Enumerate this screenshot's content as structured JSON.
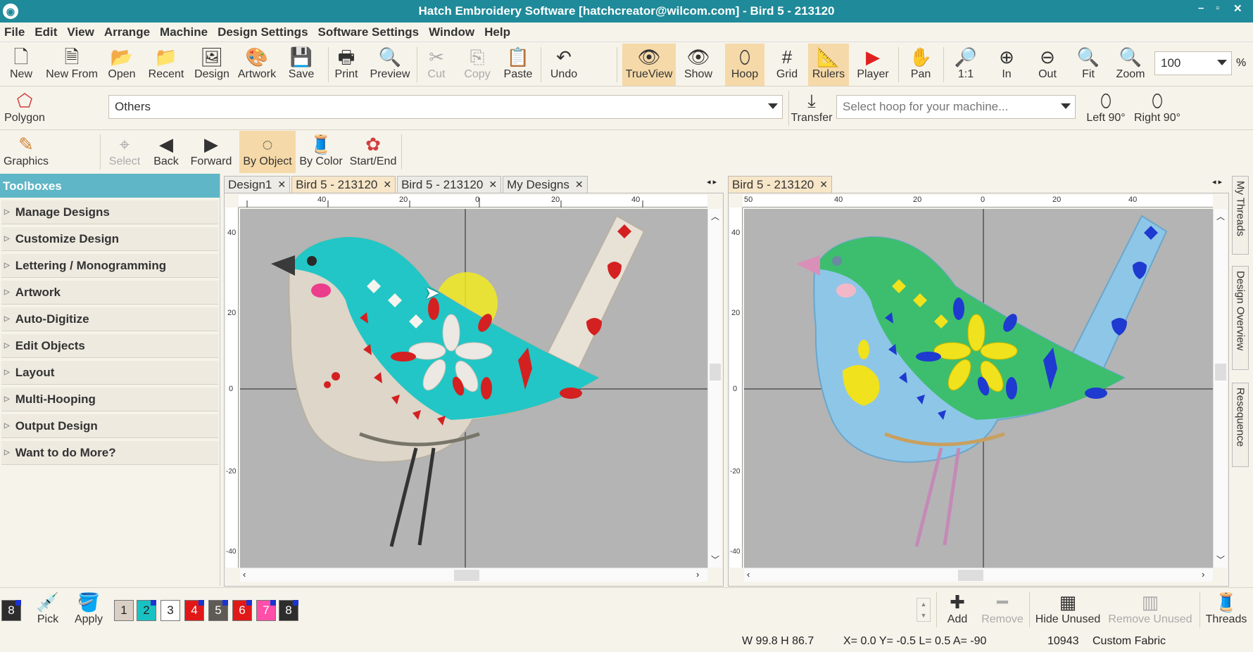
{
  "window": {
    "title": "Hatch Embroidery Software [hatchcreator@wilcom.com] - Bird 5 - 213120"
  },
  "menu": [
    "File",
    "Edit",
    "View",
    "Arrange",
    "Machine",
    "Design Settings",
    "Software Settings",
    "Window",
    "Help"
  ],
  "toolbar1": {
    "new": "New",
    "new_from": "New From",
    "open": "Open",
    "recent": "Recent",
    "design": "Design",
    "artwork": "Artwork",
    "save": "Save",
    "print": "Print",
    "preview": "Preview",
    "cut": "Cut",
    "copy": "Copy",
    "paste": "Paste",
    "undo": "Undo",
    "trueview": "TrueView",
    "show": "Show",
    "hoop": "Hoop",
    "grid": "Grid",
    "rulers": "Rulers",
    "player": "Player",
    "pan": "Pan",
    "zoom_1_1": "1:1",
    "zoom_in": "In",
    "zoom_out": "Out",
    "fit": "Fit",
    "zoom": "Zoom",
    "zoom_value": "100",
    "zoom_unit": "%"
  },
  "toolbar2": {
    "polygon": "Polygon",
    "fabric_value": "Others",
    "transfer": "Transfer",
    "hoop_placeholder": "Select hoop for your machine...",
    "left90": "Left 90°",
    "right90": "Right 90°"
  },
  "toolbar3": {
    "graphics": "Graphics",
    "select": "Select",
    "back": "Back",
    "forward": "Forward",
    "by_object": "By Object",
    "by_color": "By Color",
    "start_end": "Start/End"
  },
  "toolboxes": {
    "title": "Toolboxes",
    "items": [
      "Manage Designs",
      "Customize Design",
      "Lettering / Monogramming",
      "Artwork",
      "Auto-Digitize",
      "Edit Objects",
      "Layout",
      "Multi-Hooping",
      "Output Design",
      "Want to do More?"
    ]
  },
  "left_tabs": [
    {
      "label": "Design1"
    },
    {
      "label": "Bird 5 - 213120"
    },
    {
      "label": "Bird 5 - 213120"
    },
    {
      "label": "My Designs"
    }
  ],
  "right_tabs": [
    {
      "label": "Bird 5 - 213120"
    }
  ],
  "left_ruler": {
    "h": [
      "40",
      "20",
      "0",
      "20",
      "40"
    ],
    "v": [
      "40",
      "20",
      "0",
      "-20",
      "-40"
    ]
  },
  "right_ruler": {
    "h": [
      "50",
      "40",
      "20",
      "0",
      "20",
      "40"
    ],
    "v": [
      "40",
      "20",
      "0",
      "-20",
      "-40"
    ]
  },
  "side_panels": [
    "My Threads",
    "Design Overview",
    "Resequence"
  ],
  "bottom": {
    "current_color": "8",
    "pick": "Pick",
    "apply": "Apply",
    "swatches": [
      {
        "n": "1",
        "color": "#d9cfc4"
      },
      {
        "n": "2",
        "color": "#19c2c2"
      },
      {
        "n": "3",
        "color": "#ffffff"
      },
      {
        "n": "4",
        "color": "#e01818"
      },
      {
        "n": "5",
        "color": "#5f5a55"
      },
      {
        "n": "6",
        "color": "#e01818"
      },
      {
        "n": "7",
        "color": "#ff4fa8"
      },
      {
        "n": "8",
        "color": "#2d2d2d"
      }
    ],
    "add": "Add",
    "remove": "Remove",
    "hide_unused": "Hide Unused",
    "remove_unused": "Remove Unused",
    "threads": "Threads"
  },
  "status": {
    "wh": "W  99.8 H  86.7",
    "coords": "X=   0.0 Y=  -0.5 L=   0.5 A= -90",
    "stitches": "10943",
    "fabric": "Custom Fabric"
  }
}
